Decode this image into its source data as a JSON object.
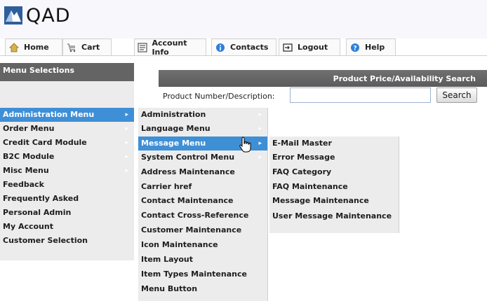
{
  "brand": {
    "name": "QAD"
  },
  "nav": {
    "tabs": [
      {
        "label": "Home",
        "icon": "home-icon"
      },
      {
        "label": "Cart",
        "icon": "cart-icon"
      },
      {
        "label": "Account Info",
        "icon": "account-icon"
      },
      {
        "label": "Contacts",
        "icon": "info-icon"
      },
      {
        "label": "Logout",
        "icon": "logout-icon"
      },
      {
        "label": "Help",
        "icon": "help-icon"
      }
    ]
  },
  "sidebar": {
    "title": "Menu Selections",
    "items": [
      {
        "label": "Administration Menu"
      },
      {
        "label": "Order Menu"
      },
      {
        "label": "Credit Card Module"
      },
      {
        "label": "B2C Module"
      },
      {
        "label": "Misc Menu"
      },
      {
        "label": "Feedback"
      },
      {
        "label": "Frequently Asked"
      },
      {
        "label": "Personal Admin"
      },
      {
        "label": "My Account"
      },
      {
        "label": "Customer Selection"
      }
    ]
  },
  "admin_submenu": {
    "items": [
      {
        "label": "Administration"
      },
      {
        "label": "Language Menu"
      },
      {
        "label": "Message Menu"
      },
      {
        "label": "System Control Menu"
      },
      {
        "label": "Address Maintenance"
      },
      {
        "label": "Carrier href"
      },
      {
        "label": "Contact Maintenance"
      },
      {
        "label": "Contact Cross-Reference"
      },
      {
        "label": "Customer Maintenance"
      },
      {
        "label": "Icon Maintenance"
      },
      {
        "label": "Item Layout"
      },
      {
        "label": "Item Types Maintenance"
      },
      {
        "label": "Menu Button"
      }
    ]
  },
  "message_submenu": {
    "items": [
      {
        "label": "E-Mail Master"
      },
      {
        "label": "Error Message"
      },
      {
        "label": "FAQ Category"
      },
      {
        "label": "FAQ Maintenance"
      },
      {
        "label": "Message Maintenance"
      },
      {
        "label": "User Message Maintenance"
      }
    ]
  },
  "search": {
    "title": "Product Price/Availability Search",
    "label": "Product Number/Description:",
    "value": "",
    "button": "Search"
  },
  "colors": {
    "highlight": "#3f8fd6",
    "panel": "#ececec",
    "header_bar": "#646464"
  }
}
